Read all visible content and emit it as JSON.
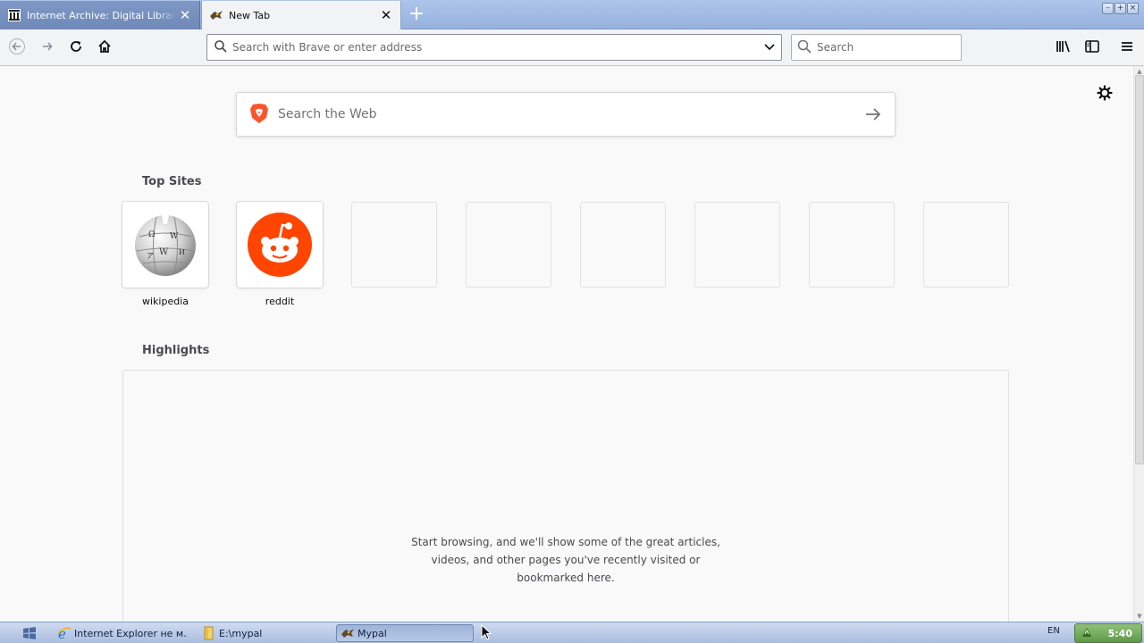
{
  "window": {
    "tabs": [
      {
        "title": "Internet Archive: Digital Library of",
        "favicon": "archive-icon",
        "active": false
      },
      {
        "title": "New Tab",
        "favicon": "mypal-icon",
        "active": true
      }
    ],
    "new_tab_label": "+"
  },
  "navbar": {
    "url_placeholder": "Search with Brave or enter address",
    "search_placeholder": "Search"
  },
  "newtab": {
    "web_search_placeholder": "Search the Web",
    "top_sites_title": "Top Sites",
    "top_sites": [
      {
        "label": "wikipedia",
        "icon": "wikipedia-icon"
      },
      {
        "label": "reddit",
        "icon": "reddit-icon"
      },
      {
        "label": ""
      },
      {
        "label": ""
      },
      {
        "label": ""
      },
      {
        "label": ""
      },
      {
        "label": ""
      },
      {
        "label": ""
      }
    ],
    "highlights_title": "Highlights",
    "highlights_empty": [
      "Start browsing, and we'll show some of the great articles,",
      "videos, and other pages you've recently visited or",
      "bookmarked here."
    ]
  },
  "taskbar": {
    "items": [
      {
        "label": "Internet Explorer не м...",
        "icon": "ie-icon",
        "pressed": false
      },
      {
        "label": "E:\\mypal",
        "icon": "folder-icon",
        "pressed": false
      },
      {
        "label": "Mypal",
        "icon": "mypal-icon",
        "pressed": true
      }
    ],
    "language": "EN",
    "clock": "5:40"
  },
  "colors": {
    "brave_orange": "#fb542b",
    "reddit_orange": "#ff4500",
    "tabstrip": "#97b2de"
  }
}
